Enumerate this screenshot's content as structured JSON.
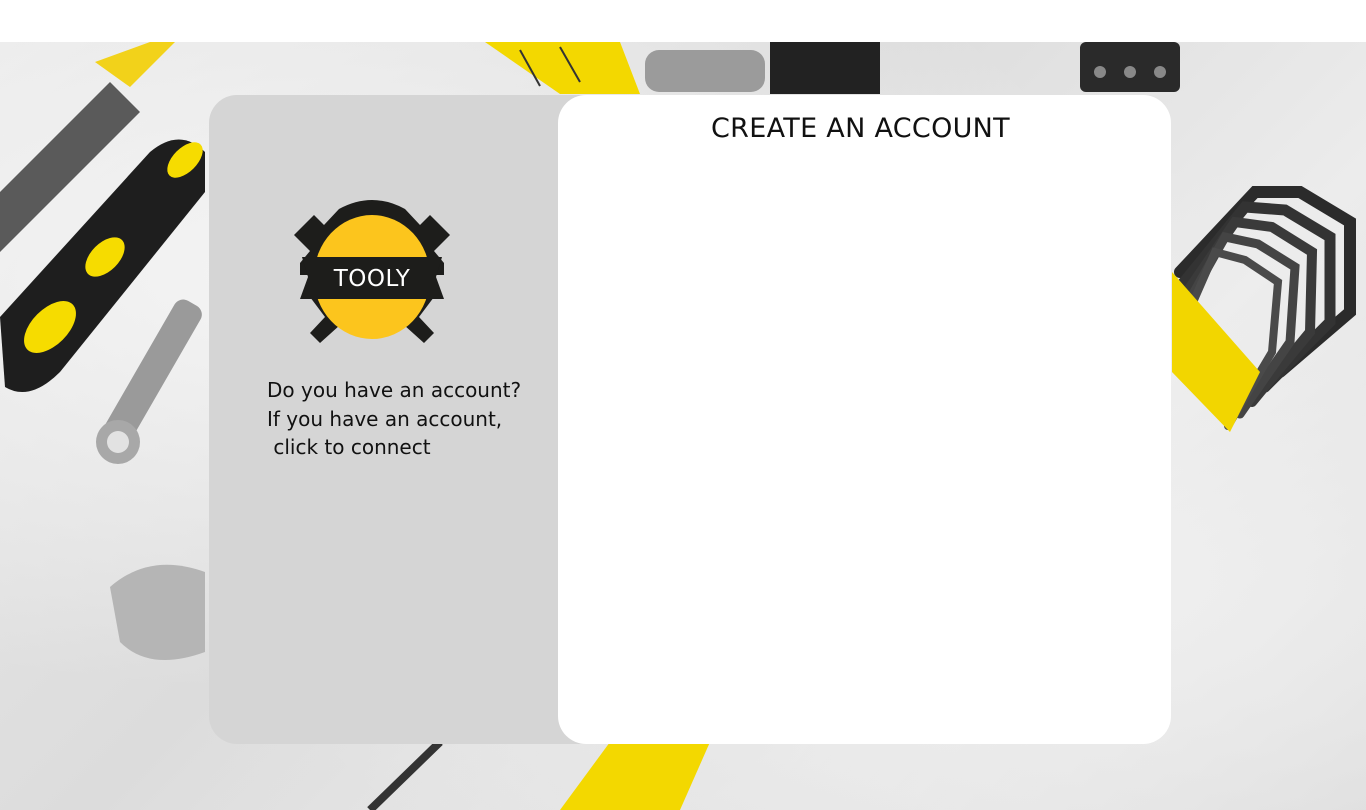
{
  "brand": {
    "logo_text": "TOOLY",
    "accent_color": "#fcc51d",
    "dark_color": "#1d1d1b"
  },
  "sidebar": {
    "prompt_line1": "Do you have an account?",
    "prompt_line2": "If you have an account,",
    "connect_label": " click to connect"
  },
  "form": {
    "title": "CREATE AN ACCOUNT"
  }
}
